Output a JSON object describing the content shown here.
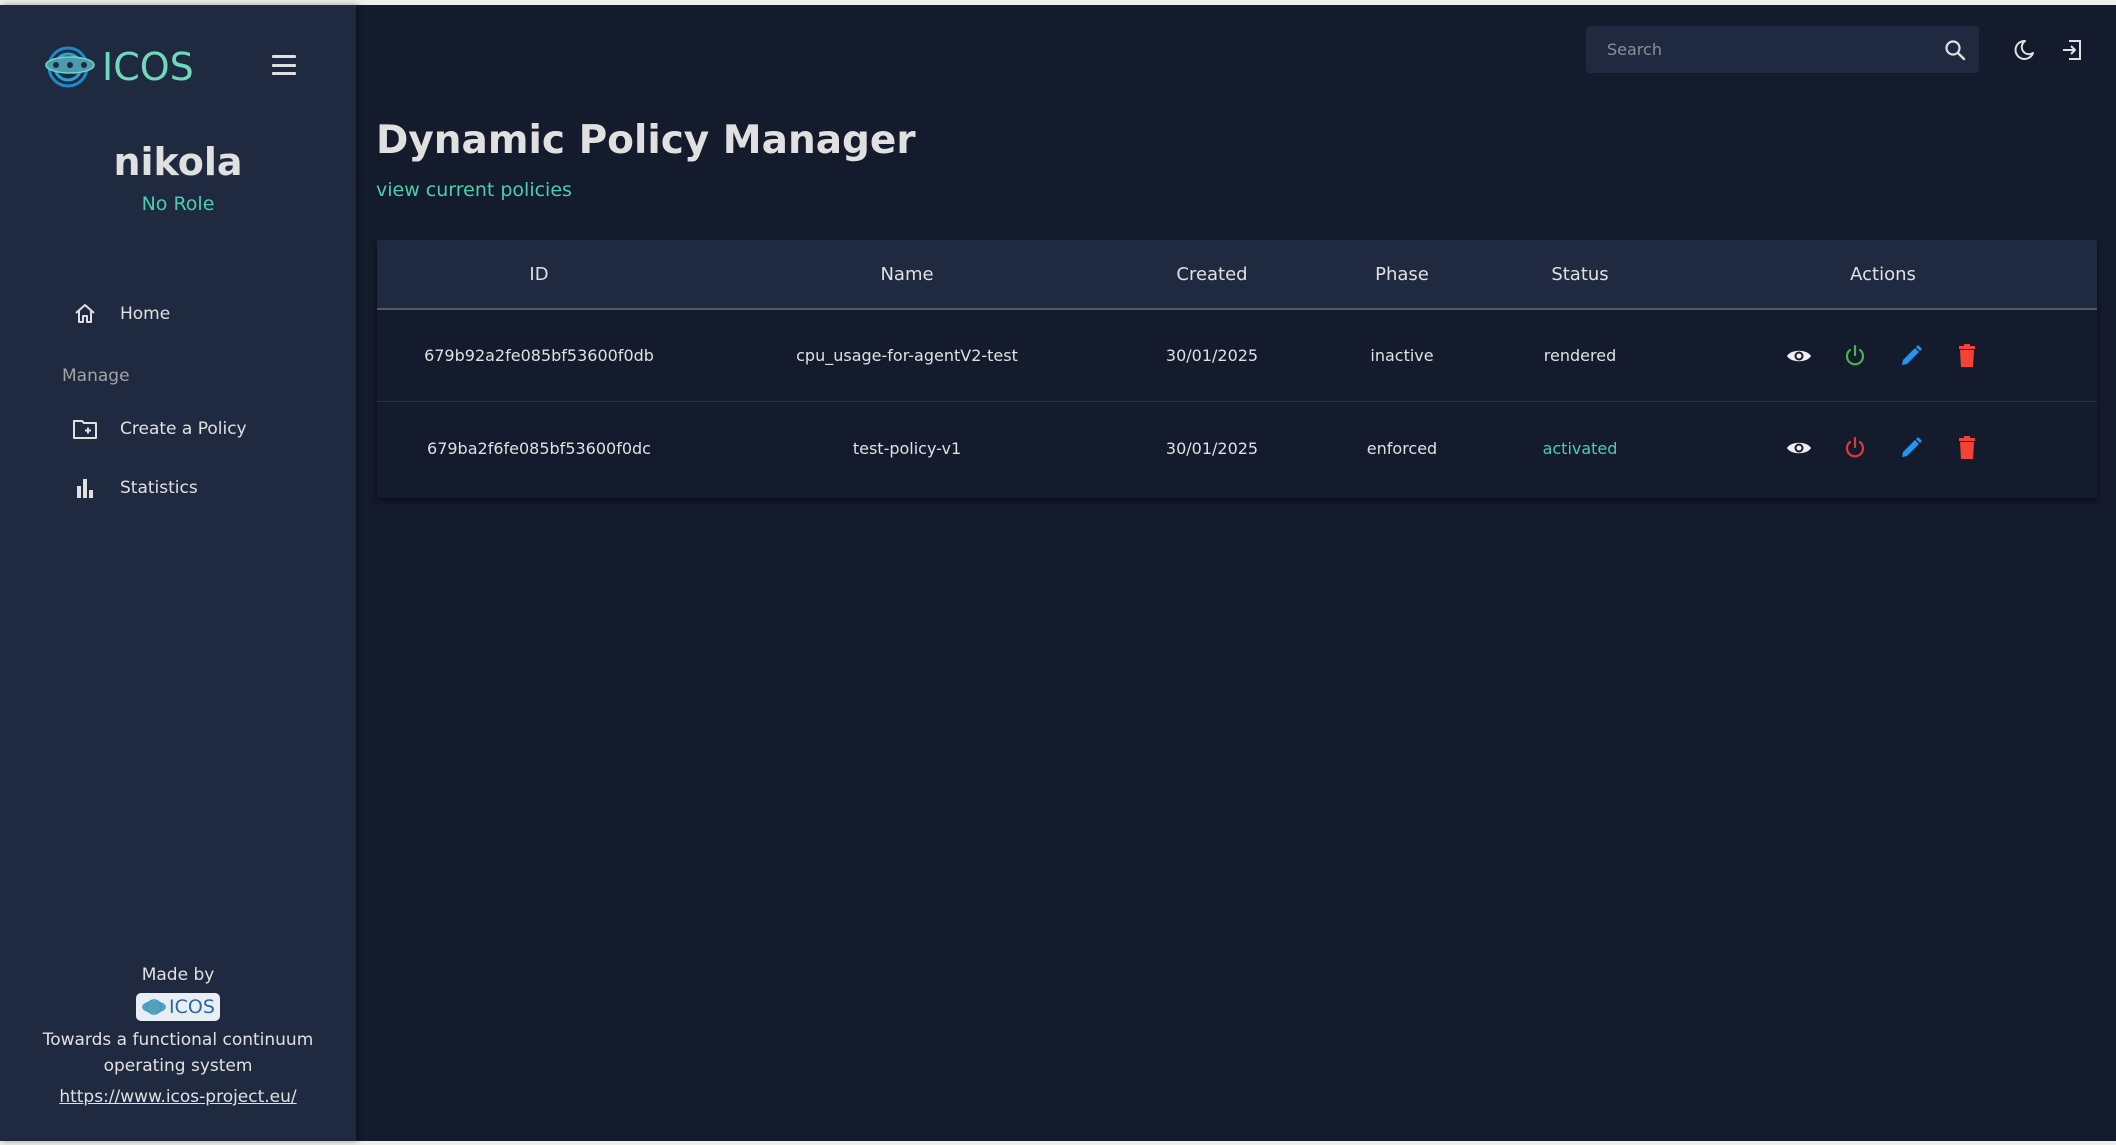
{
  "app": {
    "brand": "ICOS",
    "colors": {
      "accent": "#4cceac",
      "sidebar_bg": "#1f2a40",
      "main_bg": "#141b2d",
      "enable": "#4caf50",
      "disable": "#e53935",
      "edit": "#2196f3",
      "delete": "#f44336"
    }
  },
  "sidebar": {
    "logo_text": "ICOS",
    "menu_icon": "hamburger-icon",
    "user": {
      "name": "nikola",
      "role": "No Role"
    },
    "items": [
      {
        "label": "Home",
        "icon": "home-icon"
      }
    ],
    "section_label": "Manage",
    "manage_items": [
      {
        "label": "Create a Policy",
        "icon": "folder-plus-icon"
      },
      {
        "label": "Statistics",
        "icon": "bar-chart-icon"
      }
    ],
    "footer": {
      "made_by": "Made by",
      "logo_text": "ICOS",
      "tagline_line1": "Towards a functional continuum",
      "tagline_line2": "operating system",
      "link": "https://www.icos-project.eu/"
    }
  },
  "topbar": {
    "search": {
      "placeholder": "Search",
      "value": ""
    },
    "icons": [
      "search-icon",
      "dark-mode-icon",
      "logout-icon"
    ]
  },
  "main": {
    "title": "Dynamic Policy Manager",
    "subtitle": "view current policies",
    "table": {
      "columns": [
        "ID",
        "Name",
        "Created",
        "Phase",
        "Status",
        "Actions"
      ],
      "rows": [
        {
          "id": "679b92a2fe085bf53600f0db",
          "name": "cpu_usage-for-agentV2-test",
          "created": "30/01/2025",
          "phase": "inactive",
          "status": "rendered",
          "power_state": "enable"
        },
        {
          "id": "679ba2f6fe085bf53600f0dc",
          "name": "test-policy-v1",
          "created": "30/01/2025",
          "phase": "enforced",
          "status": "activated",
          "power_state": "disable"
        }
      ],
      "actions": [
        "view",
        "toggle-power",
        "edit",
        "delete"
      ]
    }
  }
}
